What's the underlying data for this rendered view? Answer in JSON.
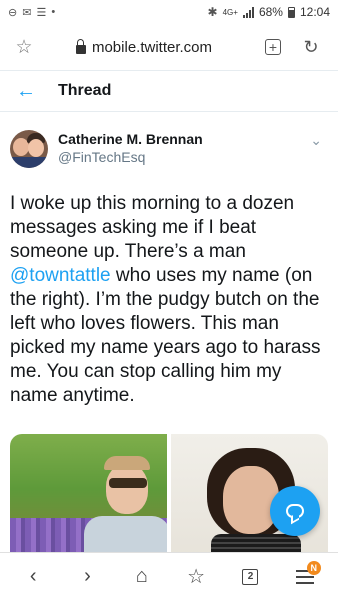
{
  "status_bar": {
    "left_icons": [
      "do-not-disturb-icon",
      "mail-icon",
      "notification-icon",
      "dot-icon"
    ],
    "network": "4G+",
    "battery": "68%",
    "time": "12:04"
  },
  "browser": {
    "url": "mobile.twitter.com",
    "tabs_count": "2",
    "menu_badge": "N"
  },
  "thread": {
    "title": "Thread"
  },
  "tweet": {
    "author_name": "Catherine M. Brennan",
    "author_handle": "@FinTechEsq",
    "text_before": "I woke up this morning to a dozen messages asking me if I beat someone up. There’s a man ",
    "mention": "@towntattle",
    "text_after": " who uses my name (on the right). I’m the pudgy butch on the left who loves flowers. This man picked my name years ago to harass me. You can stop calling him my name anytime.",
    "media_count": 2
  },
  "colors": {
    "accent": "#1da1f2",
    "text": "#14171a",
    "secondary": "#657786",
    "badge": "#f28a1d"
  }
}
